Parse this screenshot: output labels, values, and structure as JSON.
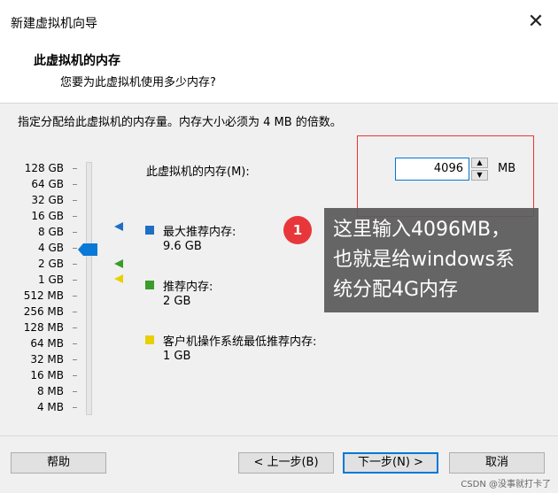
{
  "window": {
    "title": "新建虚拟机向导",
    "close_glyph": "✕"
  },
  "header": {
    "title": "此虚拟机的内存",
    "subtitle": "您要为此虚拟机使用多少内存?"
  },
  "instruction": "指定分配给此虚拟机的内存量。内存大小必须为 4 MB 的倍数。",
  "scale_labels": [
    "128 GB",
    "64 GB",
    "32 GB",
    "16 GB",
    "8 GB",
    "4 GB",
    "2 GB",
    "1 GB",
    "512 MB",
    "256 MB",
    "128 MB",
    "64 MB",
    "32 MB",
    "16 MB",
    "8 MB",
    "4 MB"
  ],
  "memory": {
    "label": "此虚拟机的内存(M):",
    "value": "4096",
    "unit": "MB"
  },
  "legend": {
    "max": {
      "title": "最大推荐内存:",
      "value": "9.6 GB",
      "color": "#1e6fc4"
    },
    "recommended": {
      "title": "推荐内存:",
      "value": "2 GB",
      "color": "#3a9c2a"
    },
    "min": {
      "title": "客户机操作系统最低推荐内存:",
      "value": "1 GB",
      "color": "#e8d000"
    }
  },
  "annotation": {
    "badge": "1",
    "text": "这里输入4096MB，也就是给windows系统分配4G内存"
  },
  "buttons": {
    "help": "帮助",
    "back": "< 上一步(B)",
    "next": "下一步(N) >",
    "cancel": "取消"
  },
  "watermark": "CSDN @没事就打卡了"
}
